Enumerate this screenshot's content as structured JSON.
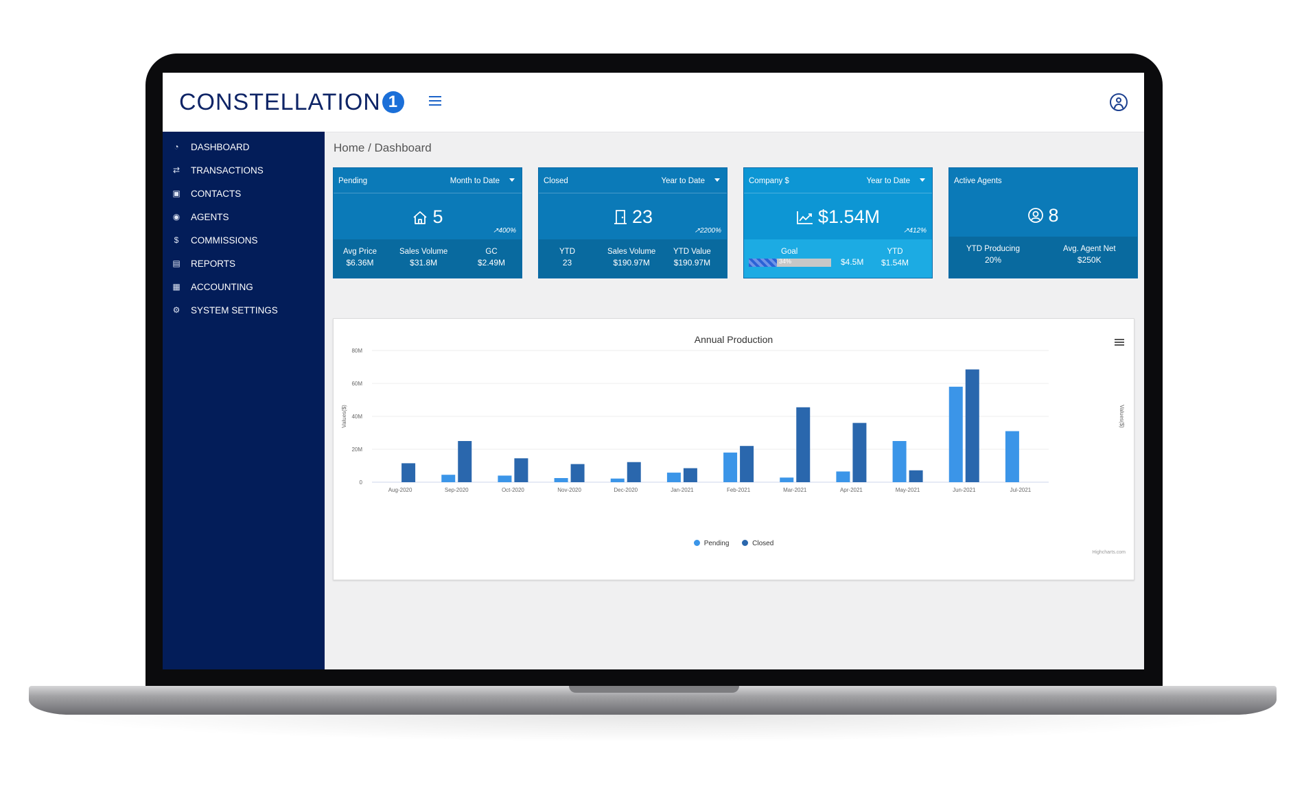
{
  "app": {
    "logo_text": "CONSTELLATION",
    "logo_badge": "1"
  },
  "sidebar": {
    "items": [
      {
        "label": "DASHBOARD",
        "icon": "gauge-icon"
      },
      {
        "label": "TRANSACTIONS",
        "icon": "arrows-icon"
      },
      {
        "label": "CONTACTS",
        "icon": "address-book-icon"
      },
      {
        "label": "AGENTS",
        "icon": "user-circle-icon"
      },
      {
        "label": "COMMISSIONS",
        "icon": "dollar-circle-icon"
      },
      {
        "label": "REPORTS",
        "icon": "report-file-icon"
      },
      {
        "label": "ACCOUNTING",
        "icon": "ledger-grid-icon"
      },
      {
        "label": "SYSTEM SETTINGS",
        "icon": "gear-icon"
      }
    ]
  },
  "breadcrumb": {
    "home": "Home",
    "separator": " / ",
    "current": "Dashboard"
  },
  "cards": {
    "pending": {
      "title": "Pending",
      "period": "Month to Date",
      "value": "5",
      "change": "400%",
      "stats": [
        {
          "label": "Avg Price",
          "value": "$6.36M"
        },
        {
          "label": "Sales Volume",
          "value": "$31.8M"
        },
        {
          "label": "GC",
          "value": "$2.49M"
        }
      ]
    },
    "closed": {
      "title": "Closed",
      "period": "Year to Date",
      "value": "23",
      "change": "2200%",
      "stats": [
        {
          "label": "YTD",
          "value": "23"
        },
        {
          "label": "Sales Volume",
          "value": "$190.97M"
        },
        {
          "label": "YTD Value",
          "value": "$190.97M"
        }
      ]
    },
    "company": {
      "title": "Company $",
      "period": "Year to Date",
      "value": "$1.54M",
      "change": "412%",
      "goal": {
        "label": "Goal",
        "percent": 34,
        "percent_text": "34%",
        "amount": "$4.5M"
      },
      "ytd": {
        "label": "YTD",
        "value": "$1.54M"
      }
    },
    "agents": {
      "title": "Active Agents",
      "value": "8",
      "stats": [
        {
          "label": "YTD Producing",
          "value": "20%"
        },
        {
          "label": "Avg. Agent Net",
          "value": "$250K"
        }
      ]
    }
  },
  "colors": {
    "sidebar": "#031d59",
    "card_blue": "#0b7ab8",
    "card_footer": "#096a9f",
    "company_blue": "#0d96d4",
    "company_footer": "#1cabe3",
    "pending_series": "#3b95e8",
    "closed_series": "#2a67ad"
  },
  "chart_data": {
    "type": "bar",
    "title": "Annual Production",
    "ylabel": "Values($)",
    "ylabel_right": "Values($)",
    "y_ticks": [
      "0",
      "20M",
      "40M",
      "60M",
      "80M"
    ],
    "ylim": [
      0,
      80
    ],
    "y_unit": "M",
    "categories": [
      "Aug-2020",
      "Sep-2020",
      "Oct-2020",
      "Nov-2020",
      "Dec-2020",
      "Jan-2021",
      "Feb-2021",
      "Mar-2021",
      "Apr-2021",
      "May-2021",
      "Jun-2021",
      "Jul-2021"
    ],
    "series": [
      {
        "name": "Pending",
        "color": "#3b95e8",
        "values": [
          0,
          4.5,
          4,
          2.5,
          2.2,
          5.8,
          18,
          2.8,
          6.5,
          25,
          58,
          31
        ]
      },
      {
        "name": "Closed",
        "color": "#2a67ad",
        "values": [
          11.5,
          25,
          14.5,
          11,
          12.2,
          8.5,
          22,
          45.5,
          36,
          7.2,
          68.5,
          0
        ]
      }
    ],
    "legend_position": "bottom-center",
    "credits": "Highcharts.com"
  }
}
